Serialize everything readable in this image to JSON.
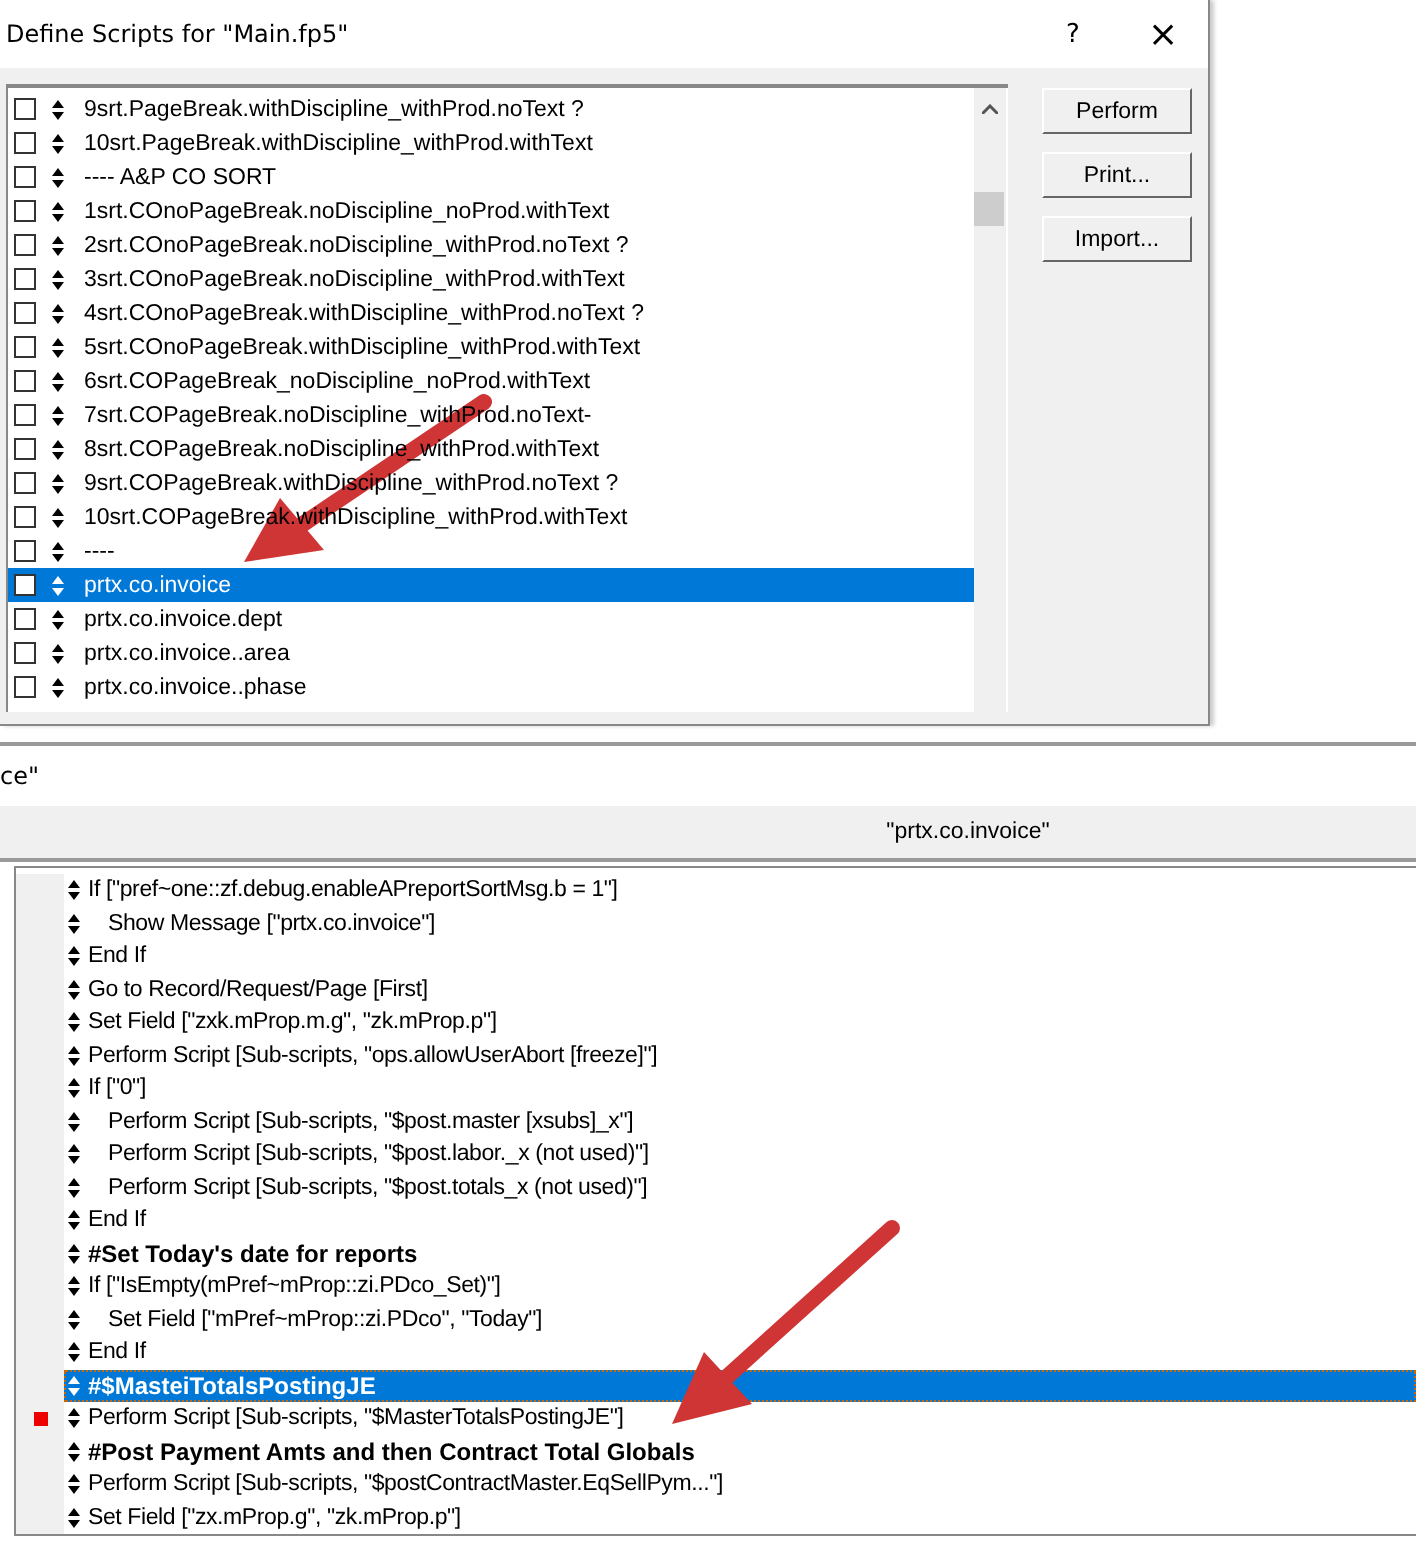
{
  "dialog": {
    "title": "Define Scripts for \"Main.fp5\"",
    "help": "?",
    "close": "×",
    "scripts": [
      {
        "name": "9srt.PageBreak.withDiscipline_withProd.noText ?",
        "checked": false,
        "selected": false
      },
      {
        "name": "10srt.PageBreak.withDiscipline_withProd.withText",
        "checked": false,
        "selected": false
      },
      {
        "name": "----  A&P CO SORT",
        "checked": false,
        "selected": false
      },
      {
        "name": "1srt.COnoPageBreak.noDiscipline_noProd.withText",
        "checked": false,
        "selected": false
      },
      {
        "name": "2srt.COnoPageBreak.noDiscipline_withProd.noText ?",
        "checked": false,
        "selected": false
      },
      {
        "name": "3srt.COnoPageBreak.noDiscipline_withProd.withText",
        "checked": false,
        "selected": false
      },
      {
        "name": "4srt.COnoPageBreak.withDiscipline_withProd.noText ?",
        "checked": false,
        "selected": false
      },
      {
        "name": "5srt.COnoPageBreak.withDiscipline_withProd.withText",
        "checked": false,
        "selected": false
      },
      {
        "name": "6srt.COPageBreak_noDiscipline_noProd.withText",
        "checked": false,
        "selected": false
      },
      {
        "name": "7srt.COPageBreak.noDiscipline_withProd.noText-",
        "checked": false,
        "selected": false
      },
      {
        "name": "8srt.COPageBreak.noDiscipline_withProd.withText",
        "checked": false,
        "selected": false
      },
      {
        "name": "9srt.COPageBreak.withDiscipline_withProd.noText ?",
        "checked": false,
        "selected": false
      },
      {
        "name": "10srt.COPageBreak.withDiscipline_withProd.withText",
        "checked": false,
        "selected": false
      },
      {
        "name": "----",
        "checked": false,
        "selected": false
      },
      {
        "name": "prtx.co.invoice",
        "checked": false,
        "selected": true
      },
      {
        "name": "prtx.co.invoice.dept",
        "checked": false,
        "selected": false
      },
      {
        "name": "prtx.co.invoice..area",
        "checked": false,
        "selected": false
      },
      {
        "name": "prtx.co.invoice..phase",
        "checked": false,
        "selected": false
      }
    ],
    "buttons": [
      "Perform",
      "Print...",
      "Import..."
    ]
  },
  "editor": {
    "title_fragment": "ce\"",
    "header": "\"prtx.co.invoice\"",
    "steps": [
      {
        "text": "If [\"pref~one::zf.debug.enableAPreportSortMsg.b = 1\"]",
        "kind": "step",
        "selected": false,
        "breakpoint": false,
        "children": [
          {
            "text": "Show Message [\"prtx.co.invoice\"]",
            "kind": "step",
            "selected": false,
            "breakpoint": false
          }
        ]
      },
      {
        "text": "End If",
        "kind": "step",
        "selected": false,
        "breakpoint": false
      },
      {
        "text": "Go to Record/Request/Page [First]",
        "kind": "step",
        "selected": false,
        "breakpoint": false
      },
      {
        "text": "Set Field [\"zxk.mProp.m.g\", \"zk.mProp.p\"]",
        "kind": "step",
        "selected": false,
        "breakpoint": false
      },
      {
        "text": "Perform Script [Sub-scripts, \"ops.allowUserAbort [freeze]\"]",
        "kind": "step",
        "selected": false,
        "breakpoint": false
      },
      {
        "text": "If [\"0\"]",
        "kind": "step",
        "selected": false,
        "breakpoint": false,
        "children": [
          {
            "text": "Perform Script [Sub-scripts, \"$post.master [xsubs]_x\"]",
            "kind": "step",
            "selected": false,
            "breakpoint": false
          },
          {
            "text": "Perform Script [Sub-scripts, \"$post.labor._x (not used)\"]",
            "kind": "step",
            "selected": false,
            "breakpoint": false
          },
          {
            "text": "Perform Script [Sub-scripts, \"$post.totals_x (not used)\"]",
            "kind": "step",
            "selected": false,
            "breakpoint": false
          }
        ]
      },
      {
        "text": "End If",
        "kind": "step",
        "selected": false,
        "breakpoint": false
      },
      {
        "text": "#Set Today's date for reports",
        "kind": "comment",
        "selected": false,
        "breakpoint": false
      },
      {
        "text": "If [\"IsEmpty(mPref~mProp::zi.PDco_Set)\"]",
        "kind": "step",
        "selected": false,
        "breakpoint": false,
        "children": [
          {
            "text": "Set Field [\"mPref~mProp::zi.PDco\", \"Today\"]",
            "kind": "step",
            "selected": false,
            "breakpoint": false
          }
        ]
      },
      {
        "text": "End If",
        "kind": "step",
        "selected": false,
        "breakpoint": false
      },
      {
        "text": "#$MasteiTotalsPostingJE",
        "kind": "comment",
        "selected": true,
        "breakpoint": false
      },
      {
        "text": "Perform Script [Sub-scripts, \"$MasterTotalsPostingJE\"]",
        "kind": "step",
        "selected": false,
        "breakpoint": true
      },
      {
        "text": "#Post Payment Amts and then Contract Total Globals",
        "kind": "comment",
        "selected": false,
        "breakpoint": false
      },
      {
        "text": "Perform Script [Sub-scripts, \"$postContractMaster.EqSellPym...\"]",
        "kind": "step",
        "selected": false,
        "breakpoint": false
      },
      {
        "text": "Set Field [\"zx.mProp.g\", \"zk.mProp.p\"]",
        "kind": "step",
        "selected": false,
        "breakpoint": false
      }
    ]
  }
}
